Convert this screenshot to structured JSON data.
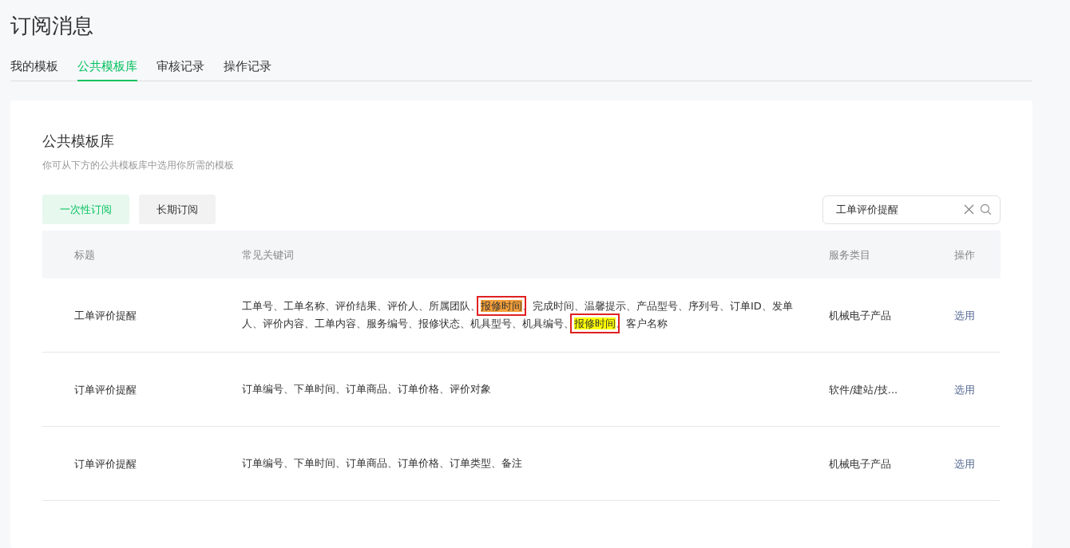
{
  "page_title": "订阅消息",
  "tabs": [
    {
      "label": "我的模板",
      "selected": false
    },
    {
      "label": "公共模板库",
      "selected": true
    },
    {
      "label": "审核记录",
      "selected": false
    },
    {
      "label": "操作记录",
      "selected": false
    }
  ],
  "card": {
    "title": "公共模板库",
    "subtitle": "你可从下方的公共模板库中选用你所需的模板",
    "filters": [
      {
        "label": "一次性订阅",
        "selected": true
      },
      {
        "label": "长期订阅",
        "selected": false
      }
    ],
    "search": {
      "value": "工单评价提醒"
    },
    "table": {
      "columns": [
        "标题",
        "常见关键词",
        "服务类目",
        "操作"
      ],
      "rows": [
        {
          "title": "工单评价提醒",
          "keywords": [
            {
              "text": "工单号、工单名称、评价结果、评价人、所属团队、"
            },
            {
              "text": "报修时间",
              "color": "#f5a03a",
              "boxed": true
            },
            {
              "text": "、完成时间、温馨提示、产品型号、序列号、订单ID、发单人、评价内容、工单内容、服务编号、报修状态、机具型号、机具编号、"
            },
            {
              "text": "报修时间",
              "color": "#ffff00",
              "boxed": true
            },
            {
              "text": "、客户名称"
            }
          ],
          "category": "机械电子产品",
          "action": "选用"
        },
        {
          "title": "订单评价提醒",
          "keywords": [
            {
              "text": "订单编号、下单时间、订单商品、订单价格、评价对象"
            }
          ],
          "category": "软件/建站/技...",
          "action": "选用"
        },
        {
          "title": "订单评价提醒",
          "keywords": [
            {
              "text": "订单编号、下单时间、订单商品、订单价格、订单类型、备注"
            }
          ],
          "category": "机械电子产品",
          "action": "选用"
        }
      ]
    }
  }
}
